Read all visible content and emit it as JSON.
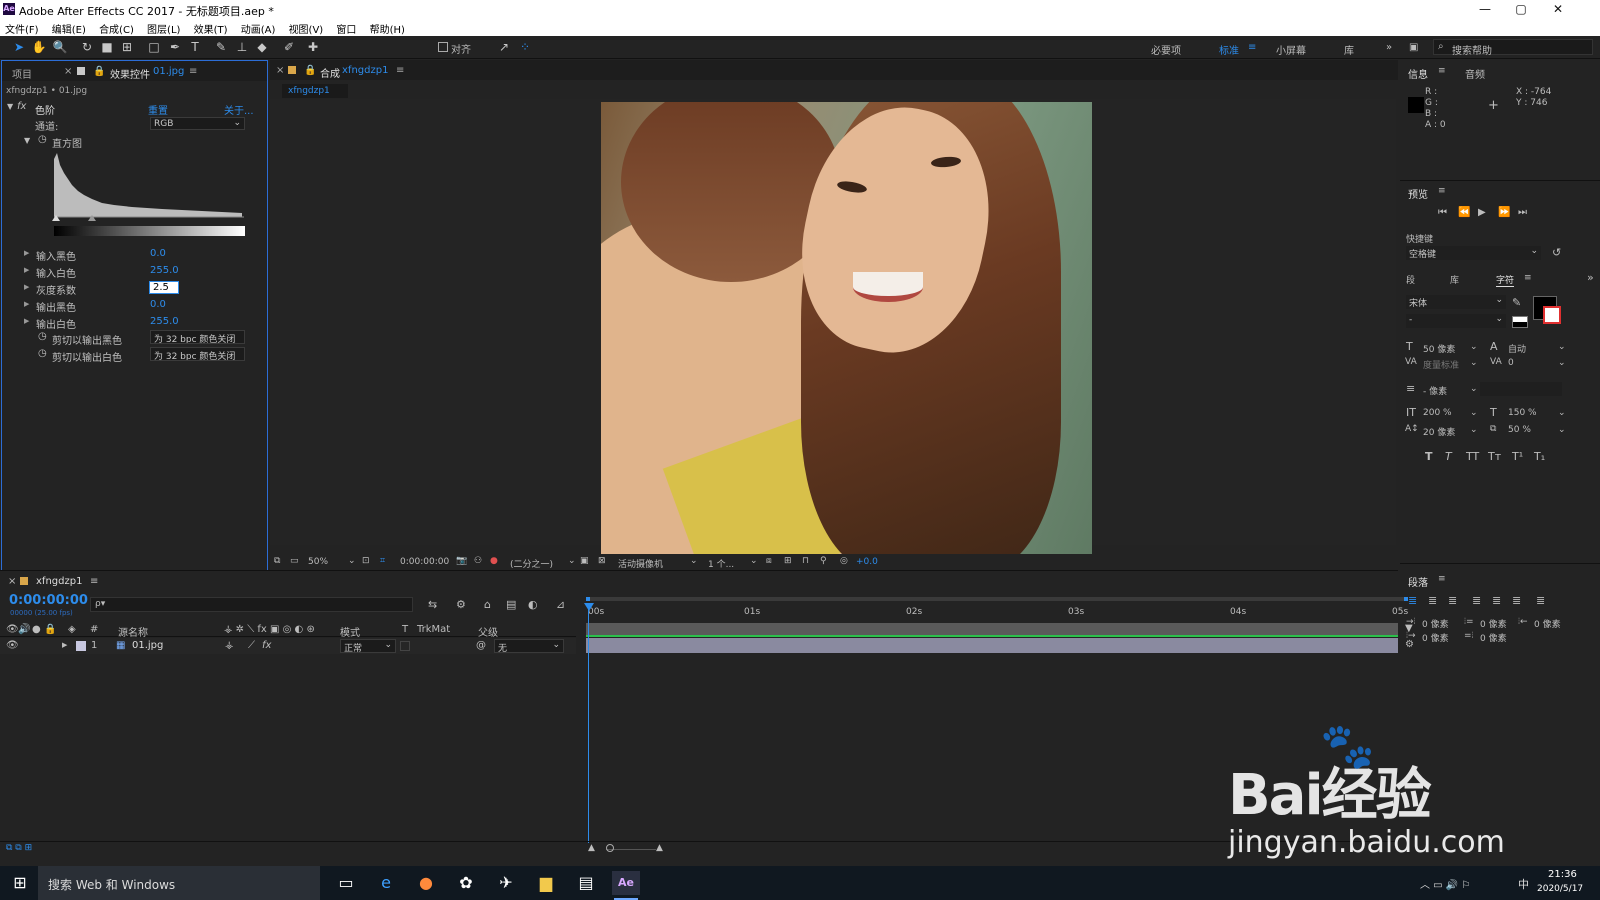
{
  "window": {
    "app_title": "Adobe After Effects CC 2017 - 无标题项目.aep *",
    "minimize": "—",
    "maximize": "▢",
    "close": "✕"
  },
  "menu": [
    "文件(F)",
    "编辑(E)",
    "合成(C)",
    "图层(L)",
    "效果(T)",
    "动画(A)",
    "视图(V)",
    "窗口",
    "帮助(H)"
  ],
  "toolbar": {
    "align_label": "对齐",
    "workspaces": [
      "必要项",
      "标准",
      "小屏幕",
      "库"
    ],
    "active_workspace": "标准",
    "search_placeholder": "搜索帮助"
  },
  "left_panel": {
    "tab_project": "项目",
    "tab_effects_prefix": "效果控件",
    "tab_effects_file": "01.jpg",
    "breadcrumb": "xfngdzp1 • 01.jpg",
    "effect_name": "色阶",
    "reset": "重置",
    "about": "关于...",
    "channel_label": "通道:",
    "channel_value": "RGB",
    "histogram_label": "直方图",
    "props": [
      {
        "label": "输入黑色",
        "value": "0.0"
      },
      {
        "label": "输入白色",
        "value": "255.0"
      },
      {
        "label": "灰度系数",
        "value": "2.5"
      },
      {
        "label": "输出黑色",
        "value": "0.0"
      },
      {
        "label": "输出白色",
        "value": "255.0"
      }
    ],
    "clip_black_label": "剪切以输出黑色",
    "clip_white_label": "剪切以输出白色",
    "clip_value": "为 32 bpc 颜色关闭"
  },
  "comp_panel": {
    "tab_prefix": "合成",
    "tab_name": "xfngdzp1",
    "subtab": "xfngdzp1",
    "zoom": "50%",
    "timecode": "0:00:00:00",
    "resolution": "(二分之一)",
    "camera": "活动摄像机",
    "views": "1 个...",
    "exposure": "+0.0"
  },
  "right_panel": {
    "info_tab": "信息",
    "audio_tab": "音频",
    "rgba": [
      "R :",
      "G :",
      "B :",
      "A : 0"
    ],
    "coord_x": "X : -764",
    "coord_y": "Y : 746",
    "preview_tab": "预览",
    "shortcut_label": "快捷键",
    "shortcut_value": "空格键",
    "tab_para_short": "段",
    "tab_lib": "库",
    "tab_char": "字符",
    "font_name": "宋体",
    "font_style": "-",
    "font_size": "50 像素",
    "leading": "自动",
    "kerning": "度量标准",
    "tracking": "0",
    "stroke": "- 像素",
    "vscale": "200 %",
    "hscale": "150 %",
    "baseline": "20 像素",
    "tsume": "50 %",
    "para_tab": "段落",
    "indent_vals": [
      "0 像素",
      "0 像素",
      "0 像素",
      "0 像素",
      "0 像素"
    ]
  },
  "timeline": {
    "tab_name": "xfngdzp1",
    "timecode": "0:00:00:00",
    "fps": "00000 (25.00 fps)",
    "search_placeholder": "ρ▾",
    "col_source": "源名称",
    "col_mode": "模式",
    "col_t": "T",
    "col_trkmat": "TrkMat",
    "col_parent": "父级",
    "layer_num": "1",
    "layer_name": "01.jpg",
    "layer_mode": "正常",
    "layer_parent": "无",
    "ruler": [
      "00s",
      "01s",
      "02s",
      "03s",
      "04s",
      "05s"
    ]
  },
  "taskbar": {
    "search_text": "搜索 Web 和 Windows",
    "time": "21:36",
    "date": "2020/5/17",
    "ime": "中"
  },
  "watermark": {
    "brand": "Bai经验",
    "url": "jingyan.baidu.com"
  },
  "colors": {
    "accent": "#2d8ceb",
    "panel_bg": "#232323",
    "layer_bar": "#8a8aa0"
  }
}
